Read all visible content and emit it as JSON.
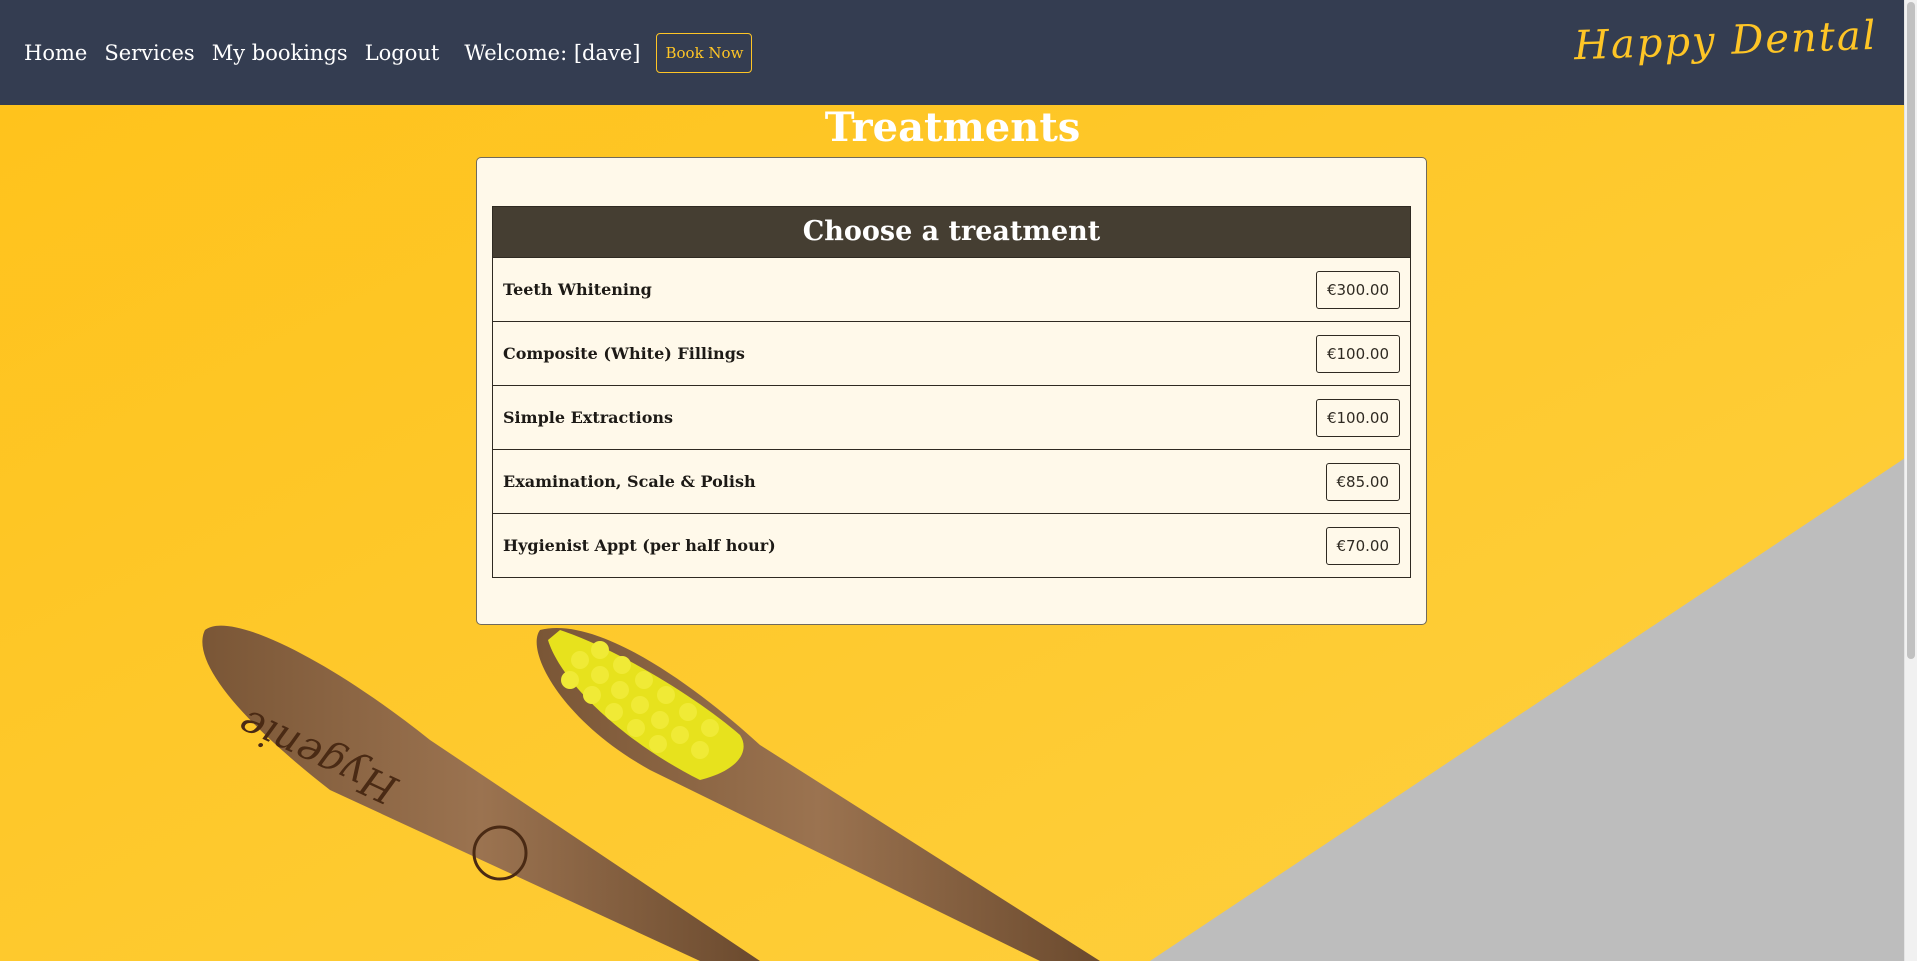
{
  "nav": {
    "links": [
      {
        "label": "Home"
      },
      {
        "label": "Services"
      },
      {
        "label": "My bookings"
      },
      {
        "label": "Logout"
      }
    ],
    "welcome": "Welcome: [dave]",
    "book_now": "Book Now",
    "brand": "Happy Dental"
  },
  "main": {
    "title": "Treatments",
    "table_heading": "Choose a treatment",
    "treatments": [
      {
        "name": "Teeth Whitening",
        "price": "€300.00"
      },
      {
        "name": "Composite (White) Fillings",
        "price": "€100.00"
      },
      {
        "name": "Simple Extractions",
        "price": "€100.00"
      },
      {
        "name": "Examination, Scale & Polish",
        "price": "€85.00"
      },
      {
        "name": "Hygienist Appt (per half hour)",
        "price": "€70.00"
      }
    ]
  },
  "background": {
    "toothbrush_engraving": "Hygenie"
  },
  "colors": {
    "navbar": "#343d51",
    "accent": "#fec526",
    "card": "#fff9ea",
    "table_header": "#453e32",
    "gray_panel": "#bdbdbd"
  }
}
